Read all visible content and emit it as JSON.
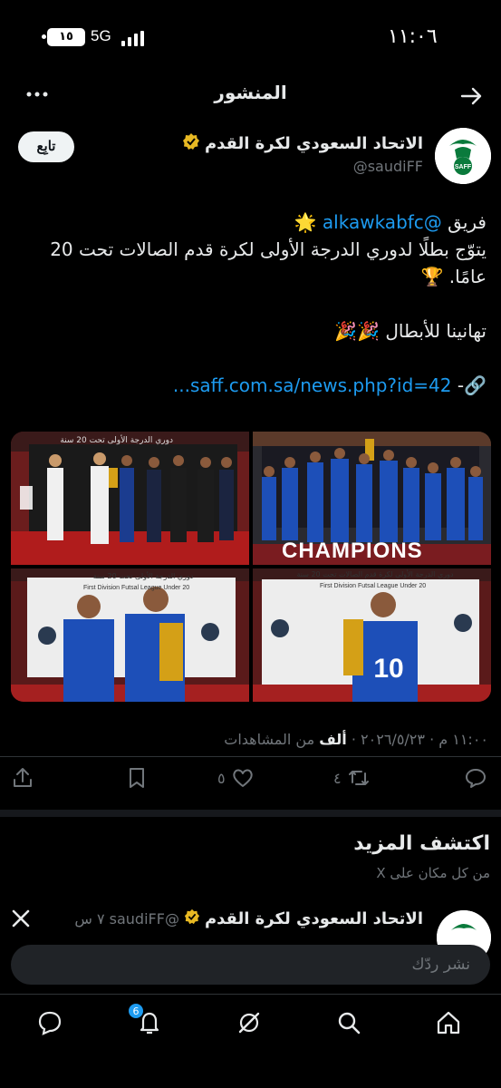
{
  "status_bar": {
    "time": "١١:٠٦",
    "network": "5G",
    "battery": "١٥"
  },
  "header": {
    "title": "المنشور"
  },
  "author": {
    "name": "الاتحاد السعودي لكرة القدم",
    "handle": "@saudiFF",
    "follow_label": "تابِع"
  },
  "tweet": {
    "line1_prefix": "فريق ",
    "mention": "@alkawkabfc",
    "line1_emoji": " 🌟",
    "line2": "يتوّج بطلًا لدوري الدرجة الأولى لكرة قدم الصالات تحت 20 عامًا. 🏆",
    "line3": "تهانينا للأبطال 🎉🎉",
    "link_prefix": "🔗- ",
    "link": "saff.com.sa/news.php?id=42..."
  },
  "media": {
    "image1_sign": "دوري الدرجة الأولى تحت 20 سنة",
    "image2_banner": "CHAMPIONS",
    "image3_sign_ar": "دوري الدرجة الأولى تحت 20 سنة",
    "image3_sign_en": "First Division Futsal League Under 20",
    "image4_sign_ar": "دوري الدرجة الأولى لكرة قدم الصالات تحت 20 سنة",
    "image4_sign_en": "First Division Futsal League Under 20"
  },
  "meta": {
    "datetime": "١١:٠٠ م · ٢٠٢٦/٥/٢٣ · ",
    "views_count": "ألف",
    "views_label": " من المشاهدات"
  },
  "actions": {
    "reply_count": "",
    "retweet_count": "٤",
    "like_count": "٥"
  },
  "discover": {
    "title": "اكتشف المزيد",
    "subtitle": "من كل مكان على X"
  },
  "next_post": {
    "name": "الاتحاد السعودي لكرة القدم",
    "handle": "@saudiFF",
    "time": "٧ س"
  },
  "reply_bar": {
    "placeholder": "نشر ردّك"
  },
  "nav": {
    "notifications_badge": "6"
  },
  "colors": {
    "accent": "#1d9bf0",
    "background": "#000000",
    "muted": "#71767b"
  }
}
